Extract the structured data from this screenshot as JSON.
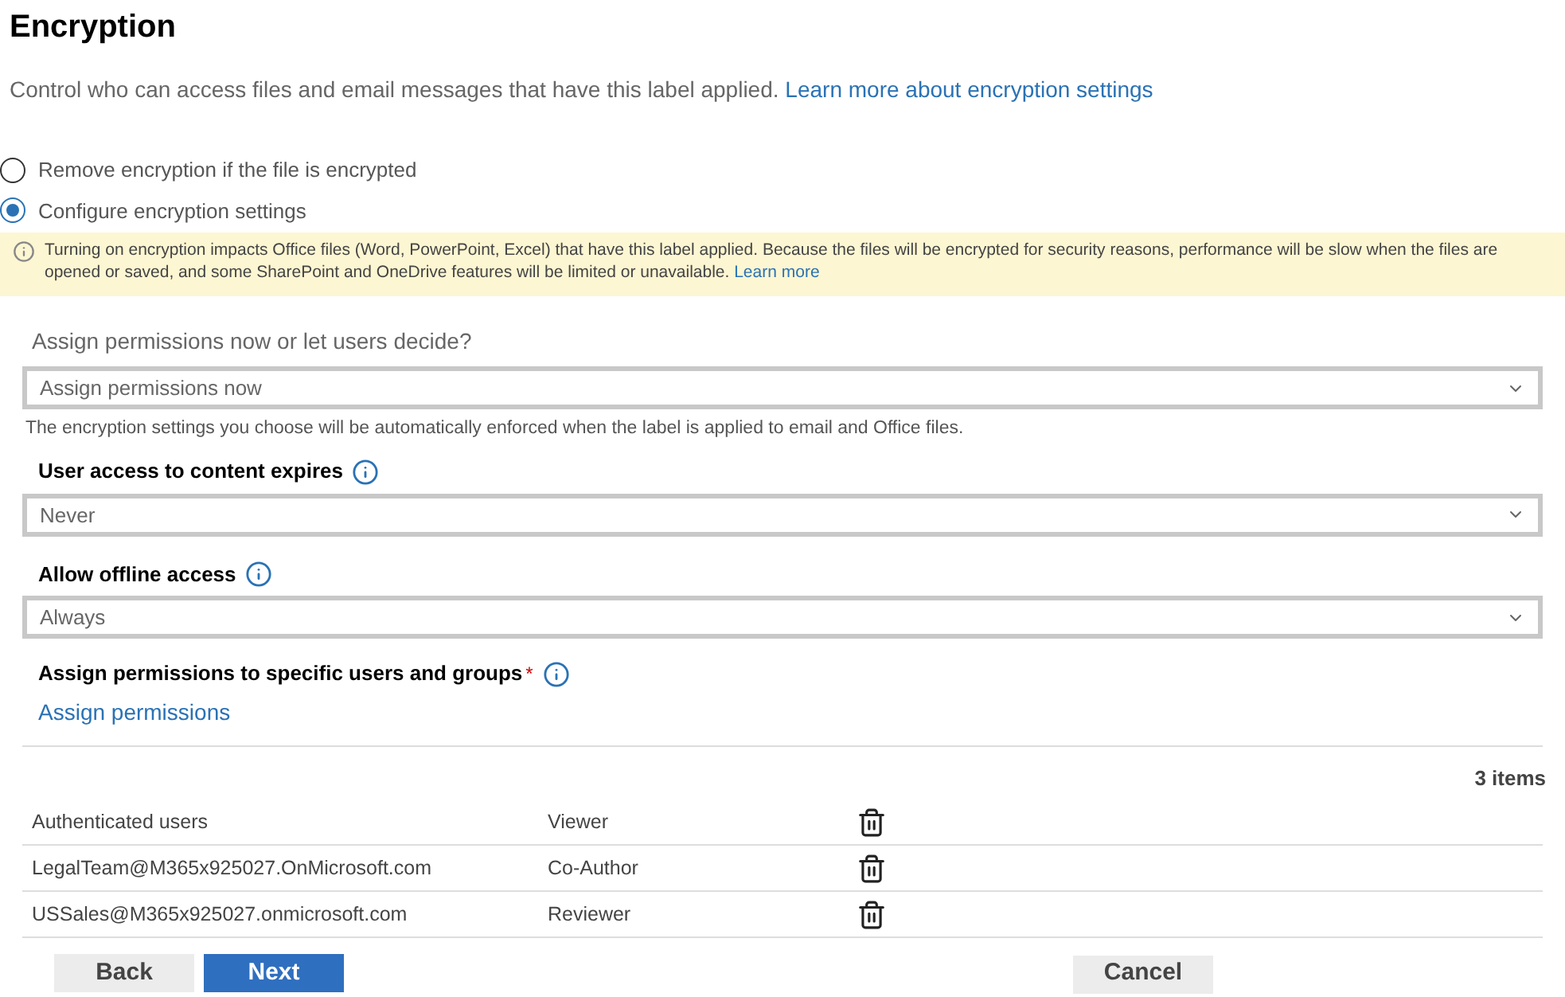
{
  "title": "Encryption",
  "description": {
    "text": "Control who can access files and email messages that have this label applied.",
    "link": "Learn more about encryption settings"
  },
  "options": [
    {
      "label": "Remove encryption if the file is encrypted",
      "selected": false
    },
    {
      "label": "Configure encryption settings",
      "selected": true
    }
  ],
  "notice": {
    "text": "Turning on encryption impacts Office files (Word, PowerPoint, Excel) that have this label applied. Because the files will be encrypted for security reasons, performance will be slow when the files are opened or saved, and some SharePoint and OneDrive features will be limited or unavailable.",
    "link": "Learn more"
  },
  "assign_mode": {
    "label": "Assign permissions now or let users decide?",
    "value": "Assign permissions now",
    "help": "The encryption settings you choose will be automatically enforced when the label is applied to email and Office files."
  },
  "fields": [
    {
      "label": "User access to content expires",
      "value": "Never"
    },
    {
      "label": "Allow offline access",
      "value": "Always"
    }
  ],
  "permissions": {
    "label": "Assign permissions to specific users and groups",
    "required_mark": "*",
    "link": "Assign permissions",
    "count": "3 items",
    "rows": [
      {
        "user": "Authenticated users",
        "role": "Viewer"
      },
      {
        "user": "LegalTeam@M365x925027.OnMicrosoft.com",
        "role": "Co-Author"
      },
      {
        "user": "USSales@M365x925027.onmicrosoft.com",
        "role": "Reviewer"
      }
    ]
  },
  "buttons": [
    {
      "label": "Back",
      "kind": "secondary"
    },
    {
      "label": "Next",
      "kind": "primary"
    },
    {
      "label": "Cancel",
      "kind": "secondary"
    }
  ]
}
